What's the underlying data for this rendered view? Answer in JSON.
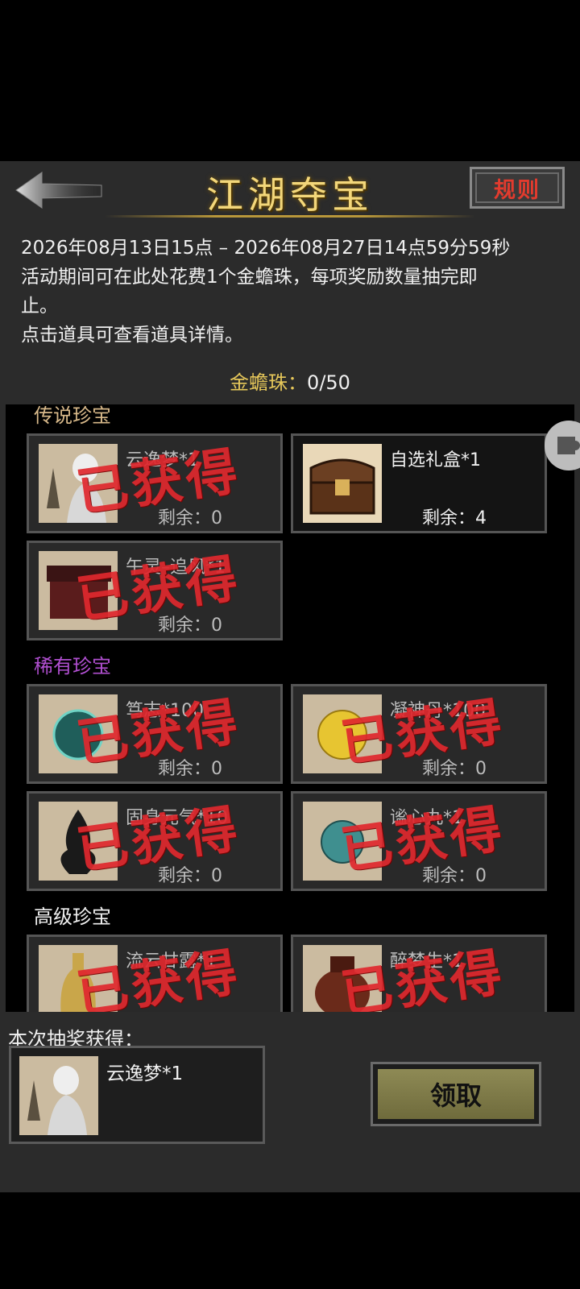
{
  "header": {
    "title": "江湖夺宝",
    "rules_label": "规则"
  },
  "description": {
    "line1": "2026年08月13日15点 – 2026年08月27日14点59分59秒",
    "line2": "活动期间可在此处花费1个金蟾珠，每项奖励数量抽完即",
    "line3": "止。",
    "line4": "点击道具可查看道具详情。"
  },
  "currency": {
    "label": "金蟾珠：",
    "value": "0/50"
  },
  "stamp_text": "已获得",
  "sections": {
    "legendary": {
      "title": "传说珍宝",
      "color": "#d8b98a",
      "items": [
        {
          "name": "云逸梦*1",
          "remain": "剩余：0",
          "claimed": true,
          "icon": "portrait-icon"
        },
        {
          "name": "自选礼盒*1",
          "remain": "剩余：4",
          "claimed": false,
          "icon": "treasure-chest-icon"
        },
        {
          "name": "午灵–追风*1",
          "remain": "剩余：0",
          "claimed": true,
          "icon": "box-icon"
        }
      ]
    },
    "rare": {
      "title": "稀有珍宝",
      "color": "#b04fd0",
      "items": [
        {
          "name": "笃志*100",
          "remain": "剩余：0",
          "claimed": true,
          "icon": "teal-orb-icon"
        },
        {
          "name": "凝神丹*100",
          "remain": "剩余：0",
          "claimed": true,
          "icon": "golden-pill-icon"
        },
        {
          "name": "固身元气*10",
          "remain": "剩余：0",
          "claimed": true,
          "icon": "black-flame-icon"
        },
        {
          "name": "谧心丸*1",
          "remain": "剩余：0",
          "claimed": true,
          "icon": "teal-pearl-icon"
        }
      ]
    },
    "advanced": {
      "title": "高级珍宝",
      "color": "#f0f0f0",
      "items": [
        {
          "name": "流云甘露*1",
          "remain": "",
          "claimed": true,
          "icon": "bottle-icon"
        },
        {
          "name": "醉梦生*1",
          "remain": "",
          "claimed": true,
          "icon": "wine-jar-icon"
        }
      ]
    }
  },
  "draw_result": {
    "label": "本次抽奖获得：",
    "item_name": "云逸梦*1"
  },
  "claim_button": "领取"
}
